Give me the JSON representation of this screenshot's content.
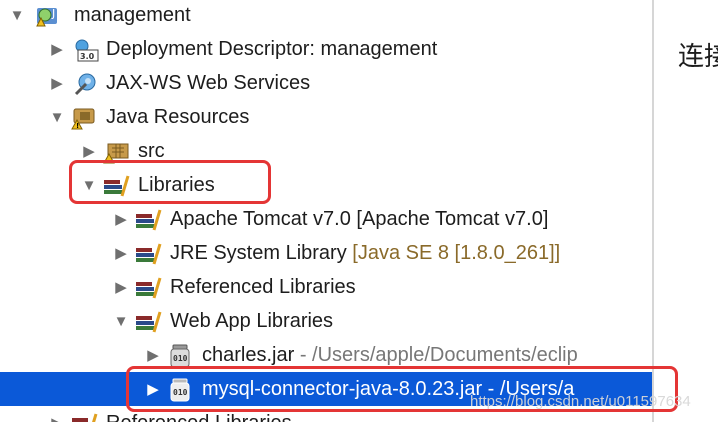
{
  "tree": {
    "project": {
      "label": "management",
      "icon": "web-project-icon"
    },
    "deployment_descriptor": {
      "label": "Deployment Descriptor: management",
      "icon": "deployment-descriptor-icon"
    },
    "jaxws": {
      "label": "JAX-WS Web Services",
      "icon": "web-services-icon"
    },
    "java_resources": {
      "label": "Java Resources",
      "icon": "java-resources-icon"
    },
    "src": {
      "label": "src",
      "icon": "package-folder-icon"
    },
    "libraries": {
      "label": "Libraries",
      "icon": "libraries-icon"
    },
    "tomcat": {
      "label": "Apache Tomcat v7.0",
      "decoration": "[Apache Tomcat v7.0]",
      "icon": "library-icon"
    },
    "jre": {
      "label": "JRE System Library",
      "decoration": "[Java SE 8 [1.8.0_261]]",
      "icon": "library-icon"
    },
    "referenced_libs": {
      "label": "Referenced Libraries",
      "icon": "library-icon"
    },
    "webapp_libs": {
      "label": "Web App Libraries",
      "icon": "library-icon"
    },
    "charles_jar": {
      "label": "charles.jar",
      "decoration": "- /Users/apple/Documents/eclip",
      "icon": "jar-icon"
    },
    "mysql_jar": {
      "label": "mysql-connector-java-8.0.23.jar - /Users/a",
      "icon": "jar-icon",
      "selected": true
    },
    "referenced_libs_bottom": {
      "label": "Referenced Libraries",
      "icon": "library-icon"
    }
  },
  "side_panel": {
    "text": "连接"
  },
  "watermark": "https://blog.csdn.net/u011597634",
  "colors": {
    "selection": "#0b59d8",
    "highlight_box": "#e43535",
    "decoration": "#8a6a2a"
  }
}
